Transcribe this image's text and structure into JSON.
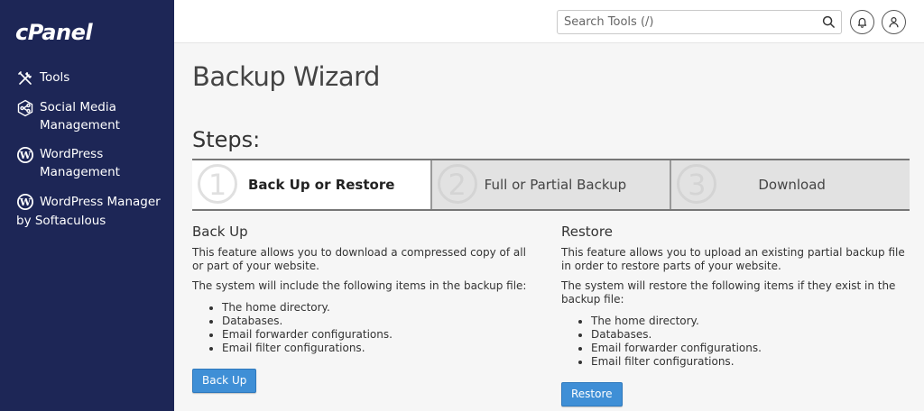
{
  "brand": {
    "logo_text": "cPanel"
  },
  "sidebar": {
    "items": [
      {
        "label": "Tools",
        "icon": "tools-icon"
      },
      {
        "label": "Social Media Management",
        "icon": "social-media-icon"
      },
      {
        "label": "WordPress Management",
        "icon": "wordpress-icon"
      },
      {
        "label": "WordPress Manager by Softaculous",
        "icon": "wordpress-icon"
      }
    ]
  },
  "topbar": {
    "search_placeholder": "Search Tools (/)",
    "notifications_icon": "bell-icon",
    "user_icon": "user-icon"
  },
  "page": {
    "title": "Backup Wizard",
    "steps_title": "Steps:"
  },
  "steps": [
    {
      "number": "1",
      "label": "Back Up or Restore",
      "active": true
    },
    {
      "number": "2",
      "label": "Full or Partial Backup",
      "active": false
    },
    {
      "number": "3",
      "label": "Download",
      "active": false
    }
  ],
  "backup": {
    "heading": "Back Up",
    "description": "This feature allows you to download a compressed copy of all or part of your website.",
    "list_intro": "The system will include the following items in the backup file:",
    "items": [
      "The home directory.",
      "Databases.",
      "Email forwarder configurations.",
      "Email filter configurations."
    ],
    "button_label": "Back Up"
  },
  "restore": {
    "heading": "Restore",
    "description": "This feature allows you to upload an existing partial backup file in order to restore parts of your website.",
    "list_intro": "The system will restore the following items if they exist in the backup file:",
    "items": [
      "The home directory.",
      "Databases.",
      "Email forwarder configurations.",
      "Email filter configurations."
    ],
    "button_label": "Restore"
  },
  "colors": {
    "sidebar_bg": "#1d2656",
    "button_bg": "#3f8fd6",
    "page_bg": "#f6f6f6"
  }
}
